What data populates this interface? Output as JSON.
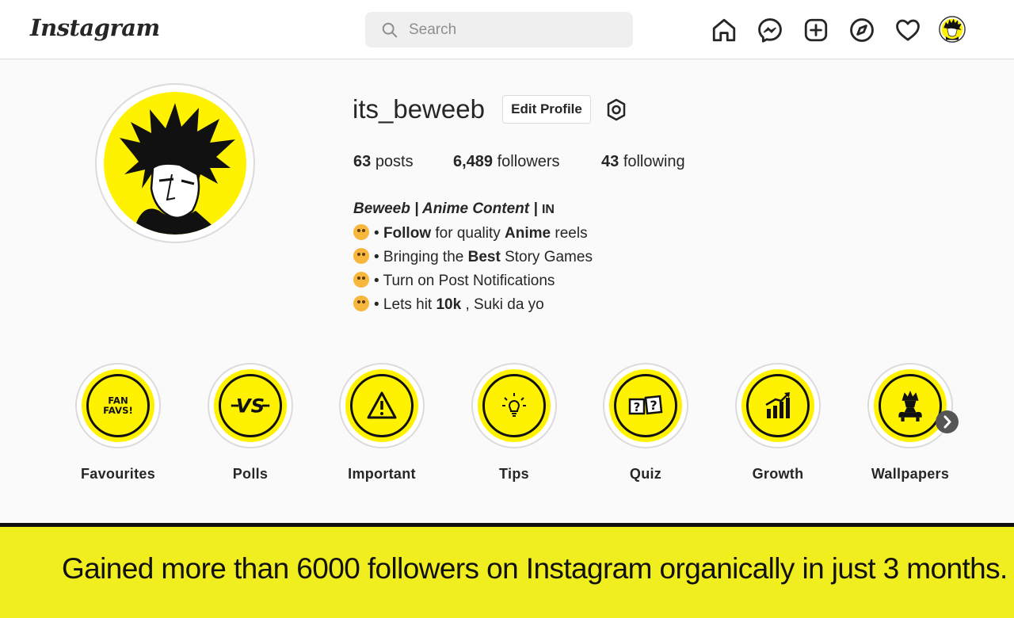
{
  "brand": {
    "logo": "Instagram"
  },
  "search": {
    "placeholder": "Search"
  },
  "nav": {
    "icons": [
      "home-icon",
      "messenger-icon",
      "new-post-icon",
      "explore-icon",
      "activity-heart-icon",
      "profile-avatar"
    ]
  },
  "profile": {
    "username": "its_beweeb",
    "edit_label": "Edit Profile",
    "stats": {
      "posts_count": "63",
      "posts_label": "posts",
      "followers_count": "6,489",
      "followers_label": "followers",
      "following_count": "43",
      "following_label": "following"
    },
    "bio": {
      "title": "Beweeb | Anime Content |",
      "region": "IN",
      "lines": [
        {
          "pre": "• ",
          "b1": "Follow",
          "mid": " for quality ",
          "b2": "Anime",
          "post": " reels"
        },
        {
          "pre": "• Bringing the ",
          "b1": "Best",
          "mid": " Story Games",
          "b2": "",
          "post": ""
        },
        {
          "pre": "• Turn on Post Notifications",
          "b1": "",
          "mid": "",
          "b2": "",
          "post": ""
        },
        {
          "pre": "• Lets hit ",
          "b1": "10k",
          "mid": " , Suki da yo",
          "b2": "",
          "post": ""
        }
      ]
    }
  },
  "highlights": [
    {
      "label": "Favourites",
      "icon": "fan-favs-icon",
      "icon_text": "FAN FAVS!"
    },
    {
      "label": "Polls",
      "icon": "versus-icon",
      "icon_text": "VS"
    },
    {
      "label": "Important",
      "icon": "warning-icon"
    },
    {
      "label": "Tips",
      "icon": "lightbulb-icon"
    },
    {
      "label": "Quiz",
      "icon": "question-cards-icon"
    },
    {
      "label": "Growth",
      "icon": "bar-growth-icon"
    },
    {
      "label": "Wallpapers",
      "icon": "character-icon"
    }
  ],
  "banner": {
    "text": "Gained more than 6000 followers on Instagram organically in just 3 months."
  },
  "colors": {
    "accent_yellow": "#fff200",
    "banner_yellow": "#f0ee1e"
  }
}
